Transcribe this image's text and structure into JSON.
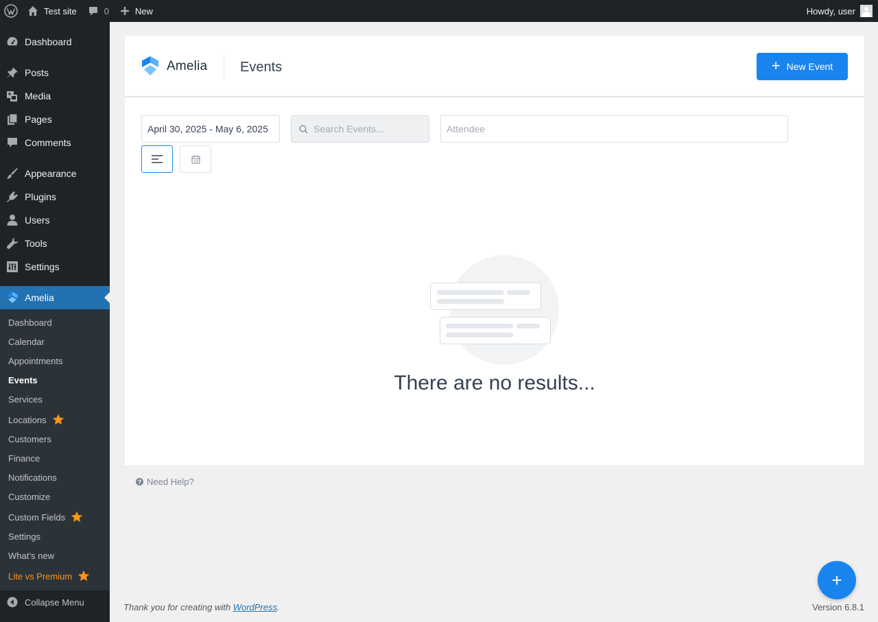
{
  "admin_bar": {
    "site_name": "Test site",
    "comments_count": "0",
    "new_label": "New",
    "greeting": "Howdy, user"
  },
  "sidebar": {
    "items": [
      {
        "label": "Dashboard",
        "icon": "dashboard-icon"
      },
      {
        "label": "Posts",
        "icon": "pin-icon"
      },
      {
        "label": "Media",
        "icon": "media-icon"
      },
      {
        "label": "Pages",
        "icon": "pages-icon"
      },
      {
        "label": "Comments",
        "icon": "comment-icon"
      },
      {
        "label": "Appearance",
        "icon": "brush-icon"
      },
      {
        "label": "Plugins",
        "icon": "plugin-icon"
      },
      {
        "label": "Users",
        "icon": "user-icon"
      },
      {
        "label": "Tools",
        "icon": "wrench-icon"
      },
      {
        "label": "Settings",
        "icon": "settings-icon"
      },
      {
        "label": "Amelia",
        "icon": "amelia-icon"
      }
    ],
    "submenu": [
      {
        "label": "Dashboard"
      },
      {
        "label": "Calendar"
      },
      {
        "label": "Appointments"
      },
      {
        "label": "Events"
      },
      {
        "label": "Services"
      },
      {
        "label": "Locations"
      },
      {
        "label": "Customers"
      },
      {
        "label": "Finance"
      },
      {
        "label": "Notifications"
      },
      {
        "label": "Customize"
      },
      {
        "label": "Custom Fields"
      },
      {
        "label": "Settings"
      },
      {
        "label": "What’s new"
      },
      {
        "label": "Lite vs Premium"
      }
    ],
    "collapse_label": "Collapse Menu"
  },
  "header": {
    "logo_text": "Amelia",
    "title": "Events",
    "new_event_label": "New Event"
  },
  "filters": {
    "date_range": "April 30, 2025 - May 6, 2025",
    "search_placeholder": "Search Events...",
    "attendee_placeholder": "Attendee"
  },
  "empty_state": {
    "message": "There are no results..."
  },
  "need_help": "Need Help?",
  "footer": {
    "thank_you_prefix": "Thank you for creating with ",
    "wordpress_link": "WordPress",
    "thank_you_suffix": ".",
    "version": "Version 6.8.1"
  },
  "colors": {
    "accent": "#1a84ee",
    "wp_dark": "#1d2327",
    "wp_current": "#2271b1",
    "premium_orange": "#ff9318"
  }
}
